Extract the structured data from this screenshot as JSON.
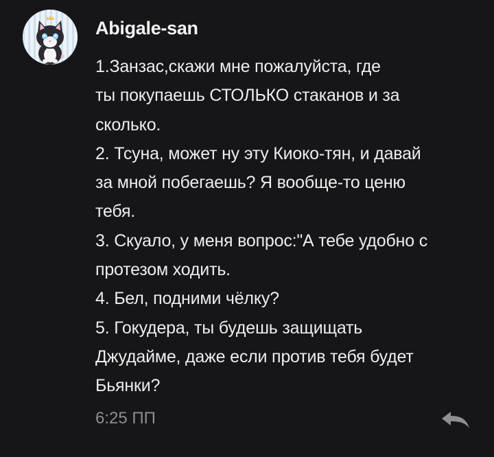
{
  "message": {
    "author": "Abigale-san",
    "avatar_icon": "cat-avatar-icon",
    "lines": [
      "1.Занзас,скажи мне пожалуйста, где",
      "ты покупаешь СТОЛЬКО стаканов и за",
      "сколько.",
      "2. Тсуна, может ну эту Киоко-тян, и давай",
      "за мной побегаешь? Я вообще-то ценю",
      "тебя.",
      "3. Скуало, у меня вопрос:\"А тебе удобно с",
      "протезом ходить.",
      "4. Бел, подними чёлку?",
      "5. Гокудера, ты будешь защищать",
      "Джудайме, даже если против тебя будет",
      "Бьянки?"
    ],
    "time": "6:25 ПП",
    "reply_icon": "reply-arrow-icon"
  },
  "colors": {
    "background": "#161618",
    "text": "#ededed",
    "muted": "#8e8e93"
  }
}
